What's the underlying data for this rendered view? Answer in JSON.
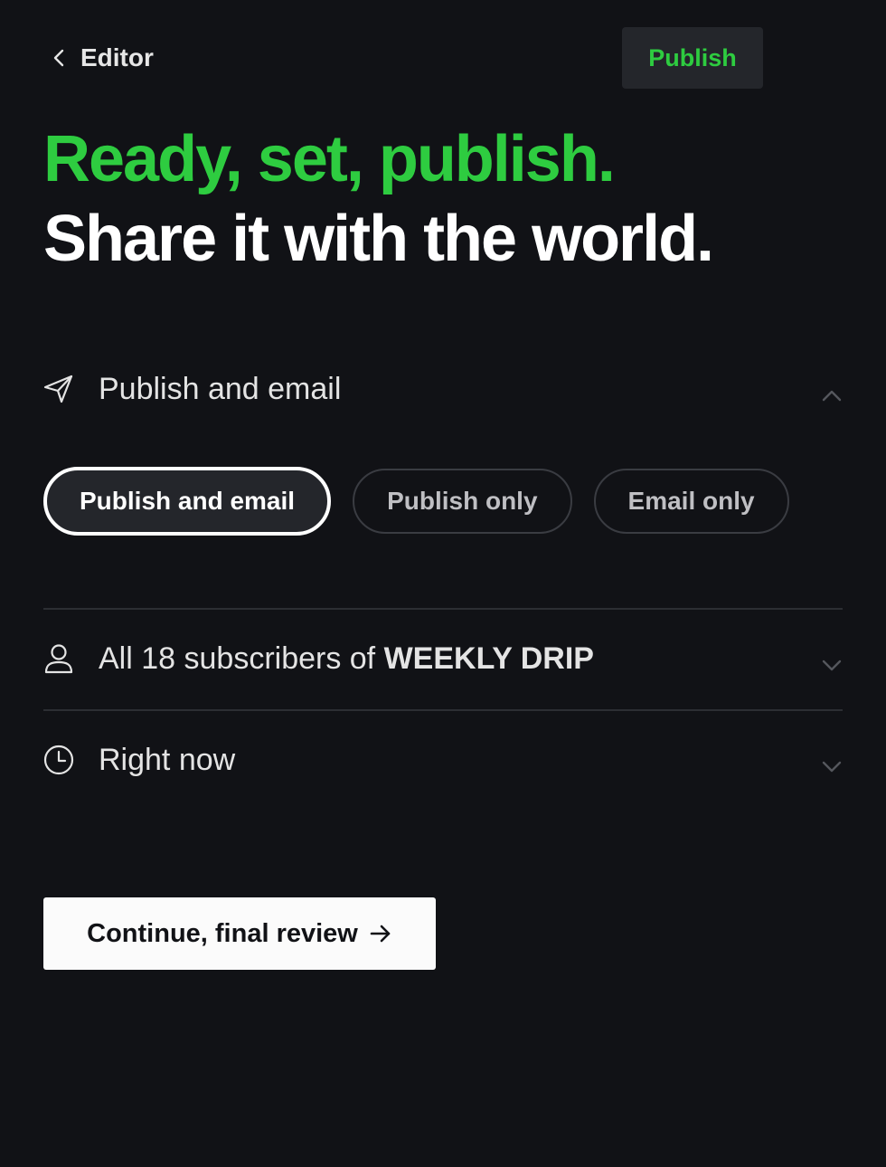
{
  "topbar": {
    "back_label": "Editor",
    "publish_label": "Publish"
  },
  "headline": {
    "line1": "Ready, set, publish.",
    "line2": "Share it with the world."
  },
  "delivery": {
    "section_label": "Publish and email",
    "options": [
      {
        "label": "Publish and email",
        "selected": true
      },
      {
        "label": "Publish only",
        "selected": false
      },
      {
        "label": "Email only",
        "selected": false
      }
    ]
  },
  "audience": {
    "prefix": "All 18 subscribers of ",
    "publication": "WEEKLY DRIP"
  },
  "schedule": {
    "label": "Right now"
  },
  "continue": {
    "label": "Continue, final review"
  },
  "colors": {
    "background": "#111216",
    "accent_green": "#2ecc40",
    "button_dark": "#24262b",
    "button_light": "#fbfbfb"
  },
  "icons": {
    "back": "chevron-left-icon",
    "send": "paper-plane-icon",
    "collapse": "chevron-up-icon",
    "user": "user-icon",
    "clock": "clock-icon",
    "expand": "chevron-down-icon",
    "arrow": "arrow-right-icon"
  }
}
